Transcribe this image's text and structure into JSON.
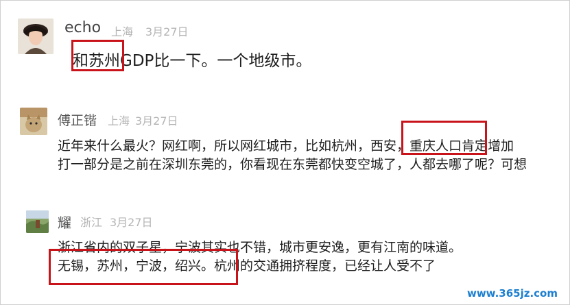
{
  "comments": [
    {
      "author": "echo",
      "location": "上海",
      "date": "3月27日",
      "lines": [
        "和苏州GDP比一下。一个地级市。"
      ]
    },
    {
      "author": "傅正锴",
      "location": "上海",
      "date": "3月27日",
      "lines": [
        "近年来什么最火？网红啊，所以网红城市，比如杭州，西安，重庆人口肯定增加",
        "打一部分是之前在深圳东莞的，你看现在东莞都快变空城了，人都去哪了呢？可想"
      ]
    },
    {
      "author": "耀",
      "location": "浙江",
      "date": "3月27日",
      "lines": [
        "浙江省内的双子星，宁波其实也不错，城市更安逸，更有江南的味道。",
        "无锡，苏州，宁波，绍兴。杭州的交通拥挤程度，已经让人受不了"
      ]
    }
  ],
  "watermark": "www.365jz.com",
  "colors": {
    "highlight_border": "#c8131a",
    "meta_text": "#b4b4b4",
    "watermark": "#1c7fd0"
  }
}
